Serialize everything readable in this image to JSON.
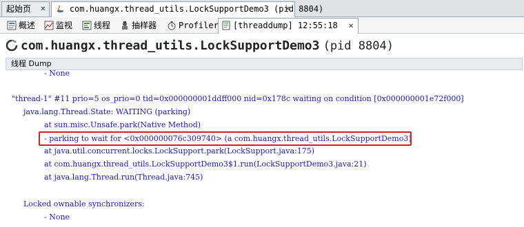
{
  "doc_tabs": [
    {
      "label": "起始页",
      "close": "✕"
    },
    {
      "label": "com.huangx.thread_utils.LockSupportDemo3 (pid 8804)",
      "close": "✕"
    }
  ],
  "sub_tabs": [
    {
      "label": "概述",
      "icon": "overview-icon"
    },
    {
      "label": "监视",
      "icon": "monitor-icon"
    },
    {
      "label": "线程",
      "icon": "threads-icon"
    },
    {
      "label": "抽样器",
      "icon": "sampler-icon"
    },
    {
      "label": "Profiler",
      "icon": "profiler-icon"
    },
    {
      "label": "[threaddump] 12:55:18",
      "icon": "threaddump-icon",
      "close": "✕"
    }
  ],
  "header": {
    "title": "com.huangx.thread_utils.LockSupportDemo3",
    "pid": "(pid 8804)"
  },
  "section_title": "线程 Dump",
  "dump_lines": [
    "- None",
    "\"thread-1\" #11 prio=5 os_prio=0 tid=0x000000001ddff000 nid=0x178c waiting on condition [0x000000001e72f000]",
    "java.lang.Thread.State: WAITING (parking)",
    "at sun.misc.Unsafe.park(Native Method)",
    "- parking to wait for  <0x000000076c309740> (a com.huangx.thread_utils.LockSupportDemo3)",
    "at java.util.concurrent.locks.LockSupport.park(LockSupport.java:175)",
    "at com.huangx.thread_utils.LockSupportDemo3$1.run(LockSupportDemo3.java:21)",
    "at java.lang.Thread.run(Thread.java:745)",
    "Locked ownable synchronizers:",
    "- None"
  ],
  "colors": {
    "dump_text": "#1a1ab4",
    "highlight_border": "#d42020",
    "tab_bar": "#dfe3e8"
  }
}
